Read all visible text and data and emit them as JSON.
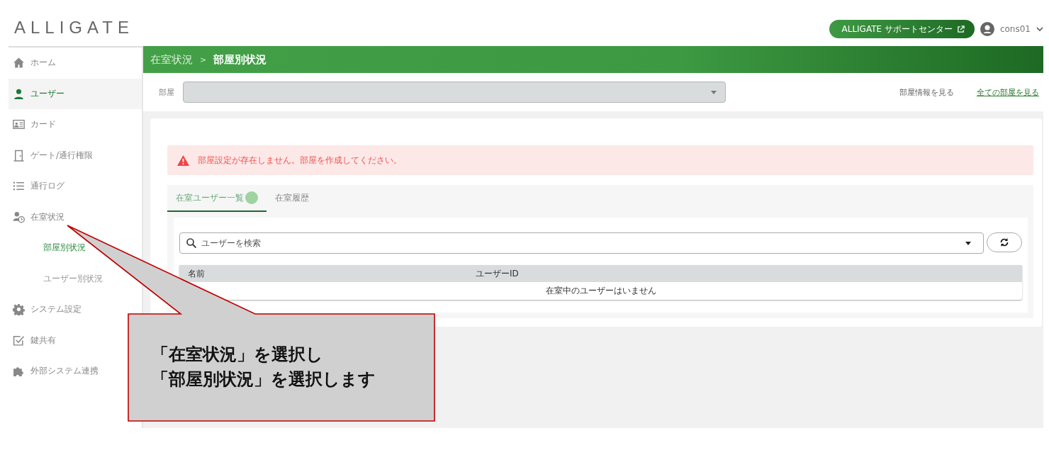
{
  "header": {
    "logo": "ALLIGATE",
    "support_button": "ALLIGATE サポートセンター",
    "user": "cons01"
  },
  "sidebar": {
    "items": [
      {
        "label": "ホーム",
        "selected": false
      },
      {
        "label": "ユーザー",
        "selected": true
      },
      {
        "label": "カード",
        "selected": false
      },
      {
        "label": "ゲート/通行権限",
        "selected": false
      },
      {
        "label": "通行ログ",
        "selected": false
      },
      {
        "label": "在室状況",
        "selected": false,
        "children": [
          {
            "label": "部屋別状況",
            "selected": true
          },
          {
            "label": "ユーザー別状況",
            "selected": false
          }
        ]
      },
      {
        "label": "システム設定",
        "selected": false
      },
      {
        "label": "鍵共有",
        "selected": false
      },
      {
        "label": "外部システム連携",
        "selected": false
      }
    ]
  },
  "breadcrumb": {
    "parent": "在室状況",
    "separator": ">",
    "current": "部屋別状況"
  },
  "room_filter": {
    "label": "部屋",
    "links": [
      {
        "text": "部屋情報を見る",
        "kind": "plain"
      },
      {
        "text": "全ての部屋を見る",
        "kind": "link"
      }
    ]
  },
  "alert": {
    "message": "部屋設定が存在しません。部屋を作成してください。"
  },
  "tabs": [
    {
      "label": "在室ユーザー一覧",
      "selected": true,
      "badge": true
    },
    {
      "label": "在室履歴",
      "selected": false,
      "badge": false
    }
  ],
  "search": {
    "placeholder": "ユーザーを検索"
  },
  "table": {
    "columns": [
      "名前",
      "ユーザーID"
    ],
    "empty_message": "在室中のユーザーはいません"
  },
  "callout": {
    "lines": [
      "「在室状況」を選択し",
      "「部屋別状況」を選択します"
    ]
  }
}
